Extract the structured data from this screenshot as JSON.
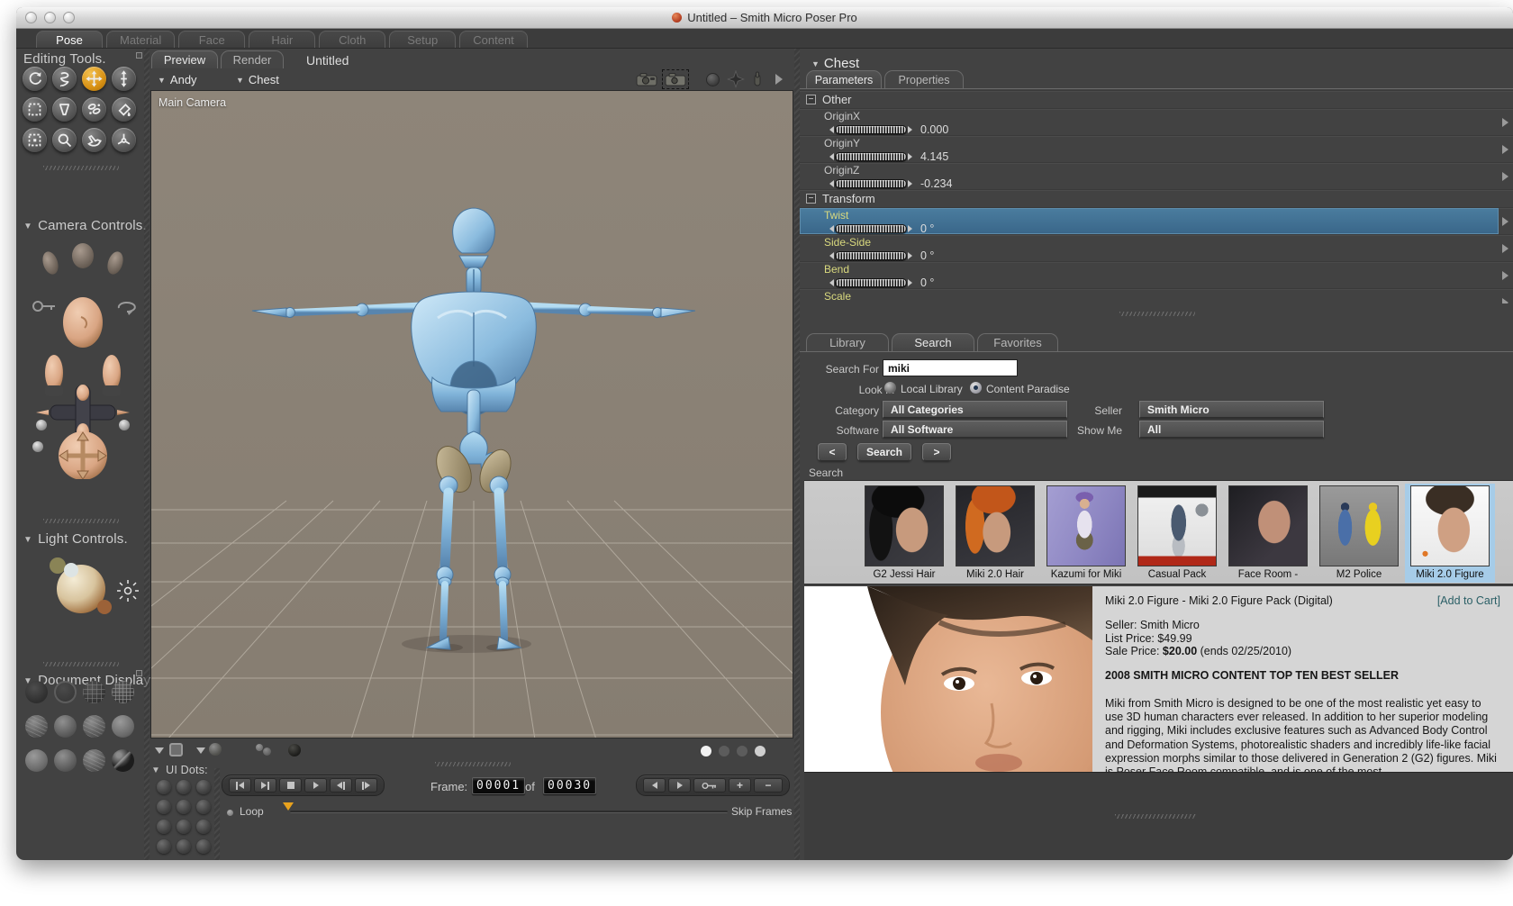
{
  "colors": {
    "accent_orange": "#e09b18",
    "selection_blue": "#40719b",
    "thumb_selection": "#a6cce8",
    "transform_label_yellow": "#d9d97e",
    "viewport_bg": "#8b8277",
    "figure_blue": "#7fb2d8",
    "add_to_cart_teal": "#2b5f66"
  },
  "window": {
    "title": "Untitled – Smith Micro Poser Pro"
  },
  "room_tabs": [
    {
      "label": "Pose",
      "active": true
    },
    {
      "label": "Material"
    },
    {
      "label": "Face"
    },
    {
      "label": "Hair"
    },
    {
      "label": "Cloth"
    },
    {
      "label": "Setup"
    },
    {
      "label": "Content"
    }
  ],
  "sidebar": {
    "editing_tools": {
      "title": "Editing Tools.",
      "tools": [
        {
          "name": "rotate"
        },
        {
          "name": "twist"
        },
        {
          "name": "translate",
          "active": true
        },
        {
          "name": "translate-in-out"
        },
        {
          "name": "scale"
        },
        {
          "name": "taper"
        },
        {
          "name": "morphing-tool"
        },
        {
          "name": "color"
        },
        {
          "name": "grouping"
        },
        {
          "name": "view-magnifier"
        },
        {
          "name": "direct-manipulation"
        },
        {
          "name": "wind-force"
        }
      ]
    },
    "camera_controls_title": "Camera Controls.",
    "light_controls_title": "Light Controls.",
    "document_display_title": "Document Display",
    "document_modes": [
      "silhouette",
      "outline",
      "wireframe",
      "hidden-line",
      "lit-wireframe",
      "flat-shaded",
      "flat-lined",
      "cartoon",
      "smooth-shaded",
      "smooth-lined",
      "texture-shaded",
      "sketch-shaded"
    ]
  },
  "viewport": {
    "tabs": [
      {
        "label": "Preview",
        "active": true
      },
      {
        "label": "Render"
      }
    ],
    "doc_title": "Untitled",
    "actor": "Andy",
    "element": "Chest",
    "camera_label": "Main Camera"
  },
  "timeline": {
    "ui_dots_label": "UI Dots:",
    "frame_label": "Frame:",
    "frame_current": "00001",
    "of_label": "of",
    "frame_total": "00030",
    "loop_label": "Loop",
    "skip_frames_label": "Skip Frames"
  },
  "params": {
    "header": "Chest",
    "tabs": [
      {
        "label": "Parameters",
        "active": true
      },
      {
        "label": "Properties"
      }
    ],
    "rows": [
      {
        "type": "group",
        "label": "Other"
      },
      {
        "type": "param",
        "label": "OriginX",
        "value": "0.000"
      },
      {
        "type": "param",
        "label": "OriginY",
        "value": "4.145"
      },
      {
        "type": "param",
        "label": "OriginZ",
        "value": "-0.234"
      },
      {
        "type": "group",
        "label": "Transform"
      },
      {
        "type": "param",
        "label": "Twist",
        "value": "0 °",
        "yellow": true,
        "selected": true
      },
      {
        "type": "param",
        "label": "Side-Side",
        "value": "0 °",
        "yellow": true
      },
      {
        "type": "param",
        "label": "Bend",
        "value": "0 °",
        "yellow": true
      },
      {
        "type": "param",
        "label": "Scale",
        "value": "",
        "yellow": true
      }
    ]
  },
  "library": {
    "tabs": [
      {
        "label": "Library"
      },
      {
        "label": "Search",
        "active": true
      },
      {
        "label": "Favorites"
      }
    ],
    "search_for_label": "Search For",
    "search_value": "miki",
    "look_in_label": "Look In",
    "radio_local": "Local Library",
    "radio_paradise": "Content Paradise",
    "category_label": "Category",
    "category_value": "All Categories",
    "seller_label": "Seller",
    "seller_value": "Smith Micro",
    "software_label": "Software",
    "software_value": "All Software",
    "showme_label": "Show Me",
    "showme_value": "All",
    "prev_label": "<",
    "search_button_label": "Search",
    "next_label": ">",
    "results_label": "Search",
    "results": [
      {
        "label": "G2 Jessi Hair",
        "art": "jessi"
      },
      {
        "label": "Miki 2.0 Hair",
        "art": "mikihair"
      },
      {
        "label": "Kazumi for Miki",
        "art": "kazumi"
      },
      {
        "label": "Casual Pack",
        "art": "casual"
      },
      {
        "label": "Face Room -",
        "art": "faceroom"
      },
      {
        "label": "M2 Police",
        "art": "police"
      },
      {
        "label": "Miki 2.0 Figure",
        "art": "mikifig",
        "selected": true
      }
    ]
  },
  "detail": {
    "title": "Miki 2.0 Figure - Miki 2.0 Figure Pack (Digital)",
    "add_to_cart": "[Add to Cart]",
    "seller": "Seller: Smith Micro",
    "list_price": "List Price: $49.99",
    "sale_price_prefix": "Sale Price: ",
    "sale_price_bold": "$20.00",
    "sale_price_suffix": " (ends 02/25/2010)",
    "headline": "2008 SMITH MICRO CONTENT TOP TEN BEST SELLER",
    "description": "Miki from Smith Micro is designed to be one of the most realistic yet easy to use 3D human characters ever released. In addition to her superior modeling and rigging, Miki includes exclusive features such as Advanced Body Control and Deformation Systems, photorealistic shaders and incredibly life-like facial expression morphs similar to those delivered in Generation 2 (G2) figures. Miki is Poser Face Room compatible, and is one of the most"
  }
}
